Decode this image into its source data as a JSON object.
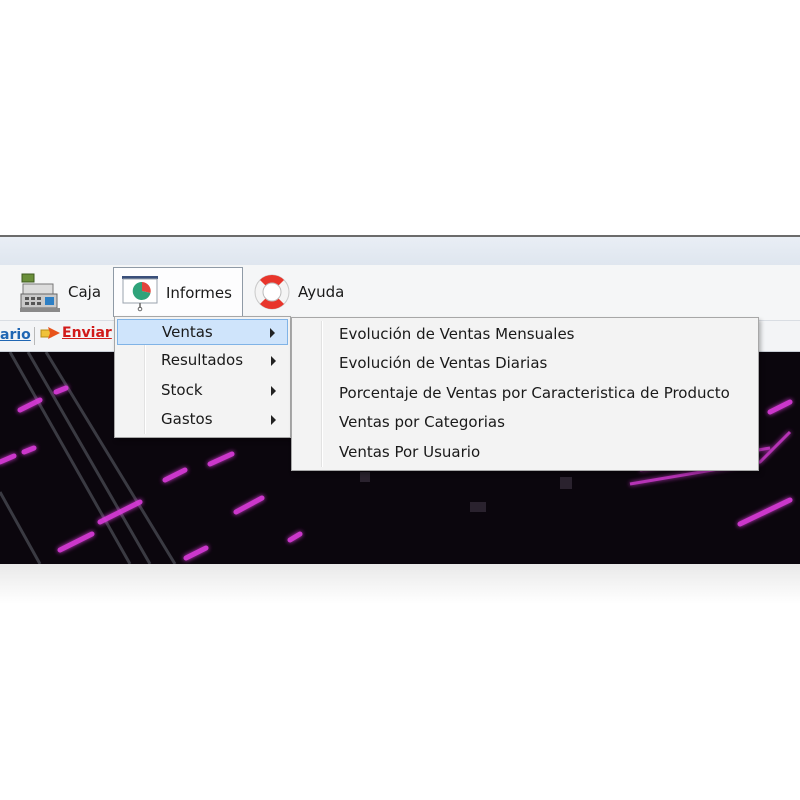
{
  "menubar": {
    "items": [
      {
        "label": "Caja",
        "icon": "cash-register-icon"
      },
      {
        "label": "Informes",
        "icon": "report-chart-icon"
      },
      {
        "label": "Ayuda",
        "icon": "lifebuoy-icon"
      }
    ]
  },
  "toolbar": {
    "link1": "ario",
    "link2": "Enviar"
  },
  "informes_menu": {
    "items": [
      {
        "label": "Ventas",
        "has_submenu": true,
        "active": true
      },
      {
        "label": "Resultados",
        "has_submenu": true
      },
      {
        "label": "Stock",
        "has_submenu": true
      },
      {
        "label": "Gastos",
        "has_submenu": true
      }
    ]
  },
  "ventas_submenu": {
    "items": [
      {
        "label": "Evolución de Ventas Mensuales"
      },
      {
        "label": "Evolución de Ventas Diarias"
      },
      {
        "label": "Porcentaje de Ventas por Caracteristica de Producto"
      },
      {
        "label": "Ventas por Categorias"
      },
      {
        "label": "Ventas Por Usuario"
      }
    ]
  },
  "colors": {
    "highlight": "#cfe4fb",
    "link_blue": "#2066b3",
    "link_red": "#d11a1a",
    "neon": "#e03ce0"
  }
}
